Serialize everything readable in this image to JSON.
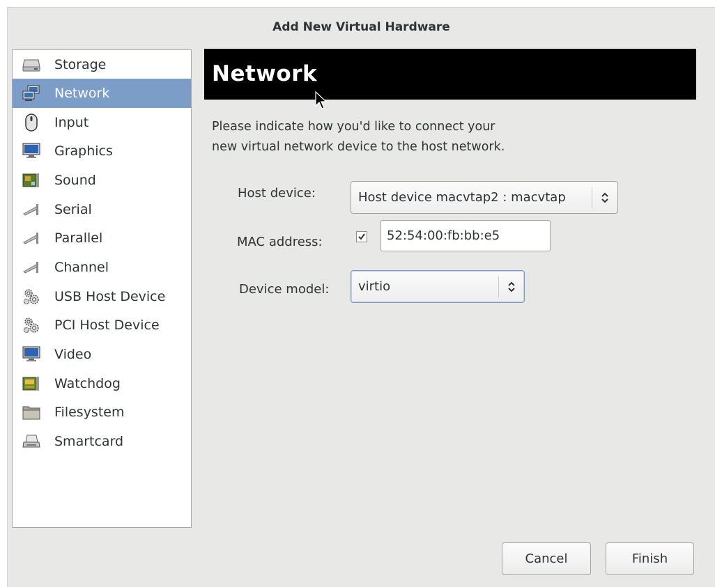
{
  "window": {
    "title": "Add New Virtual Hardware"
  },
  "sidebar": {
    "items": [
      {
        "label": "Storage",
        "icon": "storage-icon"
      },
      {
        "label": "Network",
        "icon": "network-icon",
        "selected": true
      },
      {
        "label": "Input",
        "icon": "mouse-icon"
      },
      {
        "label": "Graphics",
        "icon": "monitor-icon"
      },
      {
        "label": "Sound",
        "icon": "sound-card-icon"
      },
      {
        "label": "Serial",
        "icon": "serial-port-icon"
      },
      {
        "label": "Parallel",
        "icon": "parallel-port-icon"
      },
      {
        "label": "Channel",
        "icon": "channel-icon"
      },
      {
        "label": "USB Host Device",
        "icon": "usb-gears-icon"
      },
      {
        "label": "PCI Host Device",
        "icon": "pci-gears-icon"
      },
      {
        "label": "Video",
        "icon": "video-monitor-icon"
      },
      {
        "label": "Watchdog",
        "icon": "watchdog-card-icon"
      },
      {
        "label": "Filesystem",
        "icon": "folder-icon"
      },
      {
        "label": "Smartcard",
        "icon": "smartcard-reader-icon"
      }
    ]
  },
  "main": {
    "header": "Network",
    "description_line1": "Please indicate how you'd like to connect your",
    "description_line2": "new virtual network device to the host network.",
    "host_device": {
      "label": "Host device:",
      "value": "Host device macvtap2 : macvtap"
    },
    "mac_address": {
      "label": "MAC address:",
      "checked": true,
      "value": "52:54:00:fb:bb:e5"
    },
    "device_model": {
      "label": "Device model:",
      "value": "virtio"
    }
  },
  "buttons": {
    "cancel": "Cancel",
    "finish": "Finish"
  },
  "colors": {
    "selection": "#7c9dc7",
    "header_bg": "#000000",
    "window_bg": "#e8e8e7"
  }
}
